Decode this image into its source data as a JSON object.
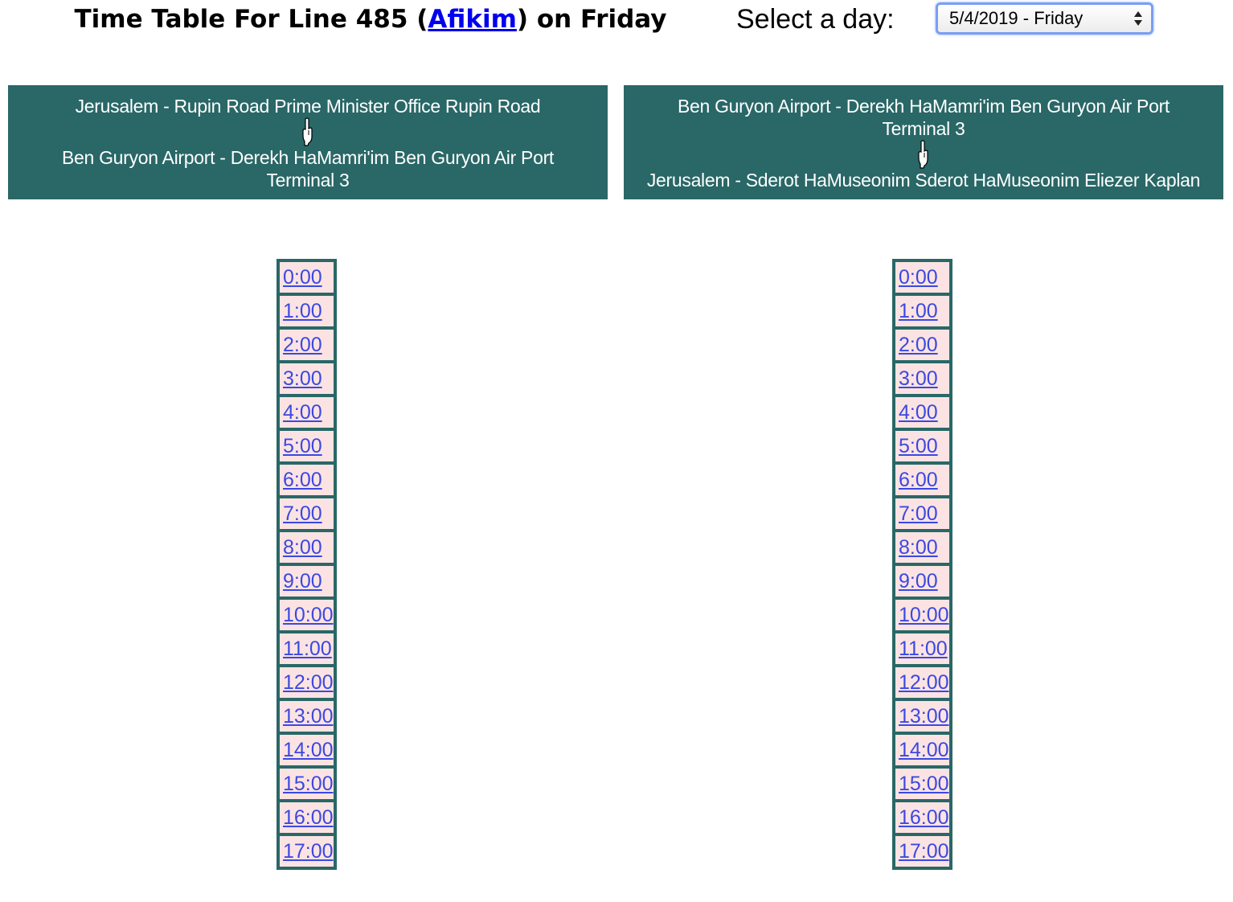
{
  "header": {
    "title_prefix": "Time Table For Line 485 (",
    "operator_link": "Afikim",
    "title_suffix": ") on Friday",
    "select_label": "Select a day:",
    "selected_day": "5/4/2019 - Friday"
  },
  "directions": [
    {
      "from": "Jerusalem - Rupin Road Prime Minister Office Rupin Road",
      "to_line1": "Ben Guryon Airport - Derekh HaMamri'im Ben Guryon Air Port",
      "to_line2": "Terminal 3",
      "hours": [
        "0:00",
        "1:00",
        "2:00",
        "3:00",
        "4:00",
        "5:00",
        "6:00",
        "7:00",
        "8:00",
        "9:00",
        "10:00",
        "11:00",
        "12:00",
        "13:00",
        "14:00",
        "15:00",
        "16:00",
        "17:00"
      ]
    },
    {
      "from_line1": "Ben Guryon Airport - Derekh HaMamri'im Ben Guryon Air Port",
      "from_line2": "Terminal 3",
      "to": "Jerusalem - Sderot HaMuseonim Sderot HaMuseonim Eliezer Kaplan",
      "hours": [
        "0:00",
        "1:00",
        "2:00",
        "3:00",
        "4:00",
        "5:00",
        "6:00",
        "7:00",
        "8:00",
        "9:00",
        "10:00",
        "11:00",
        "12:00",
        "13:00",
        "14:00",
        "15:00",
        "16:00",
        "17:00"
      ]
    }
  ],
  "colors": {
    "header_bg": "#2a6767",
    "cell_bg": "#fce3e3",
    "link": "#3b49e0"
  },
  "icons": {
    "direction": "pointing-down-hand-icon"
  }
}
